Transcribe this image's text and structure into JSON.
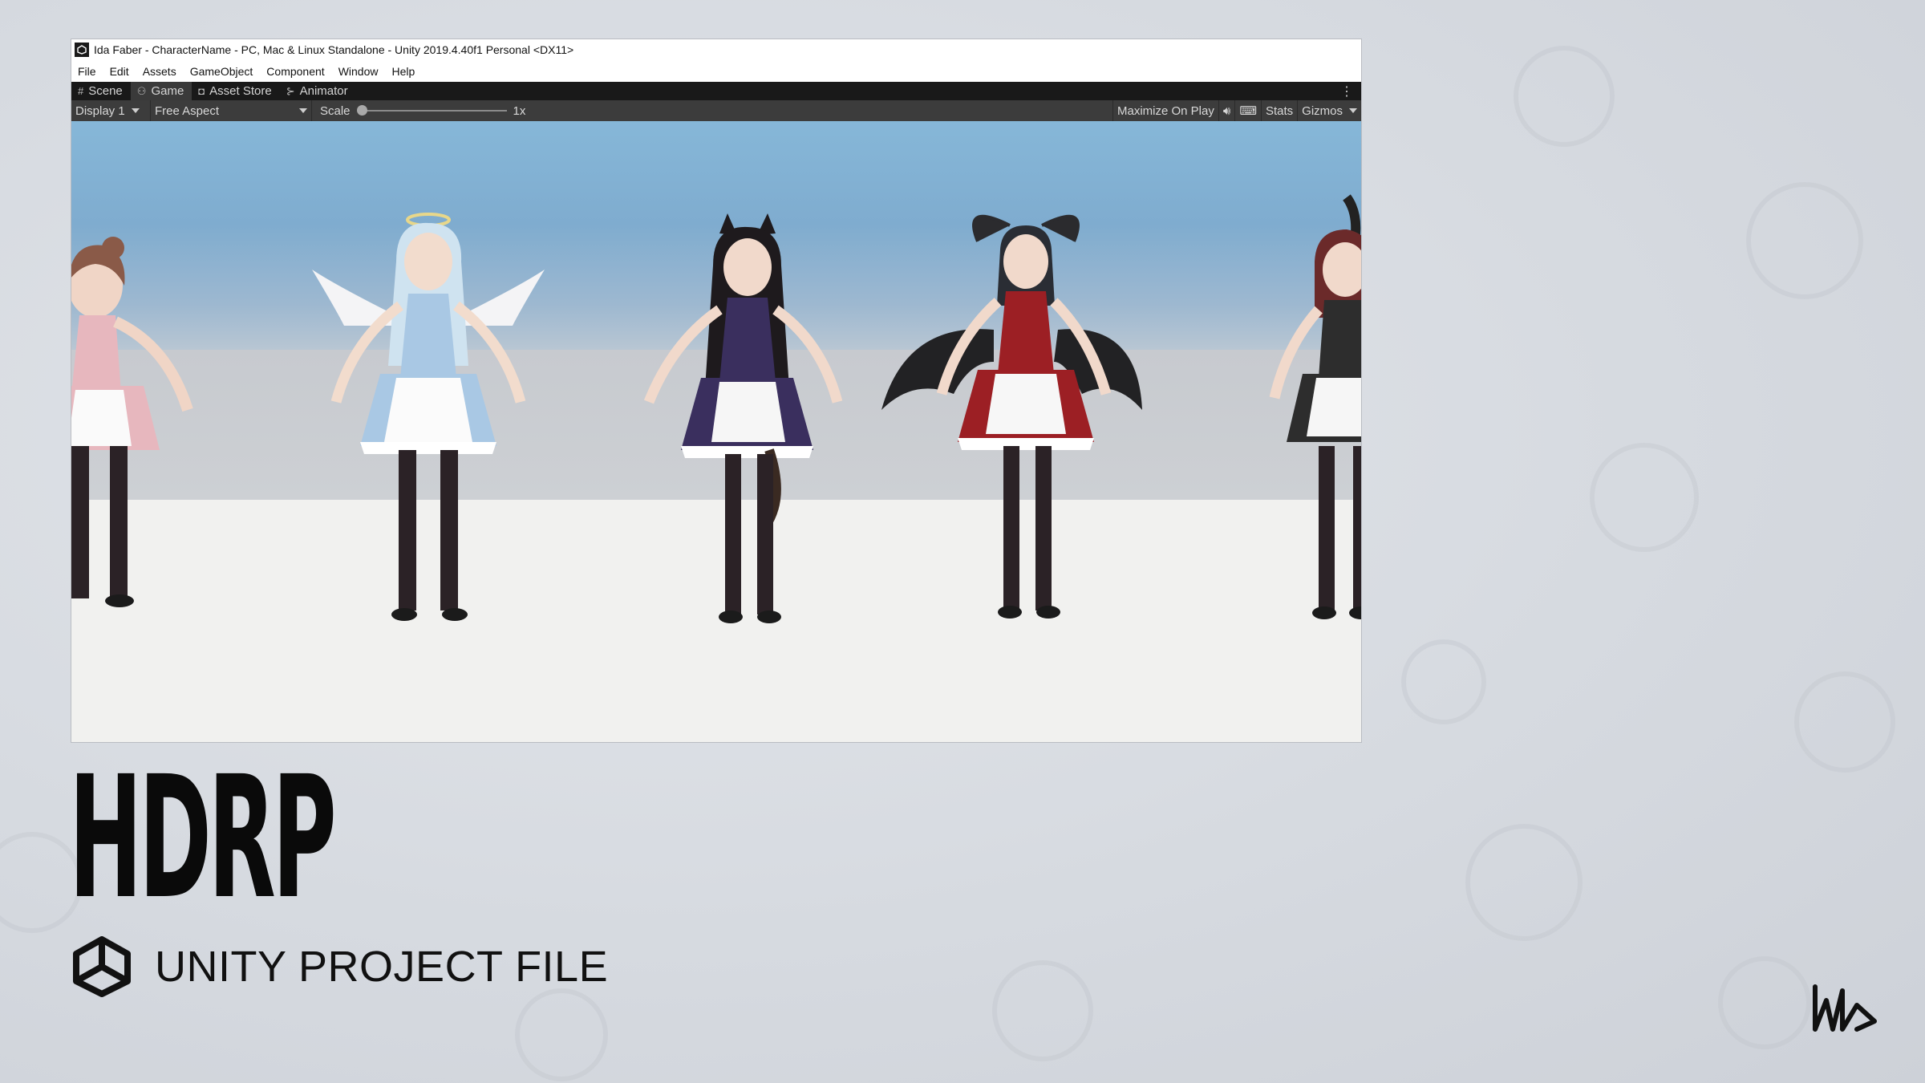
{
  "window": {
    "title": "Ida Faber - CharacterName - PC, Mac & Linux Standalone - Unity 2019.4.40f1 Personal <DX11>"
  },
  "menu": [
    "File",
    "Edit",
    "Assets",
    "GameObject",
    "Component",
    "Window",
    "Help"
  ],
  "tabs": [
    {
      "label": "Scene",
      "icon": "grid-icon"
    },
    {
      "label": "Game",
      "icon": "gamepad-icon"
    },
    {
      "label": "Asset Store",
      "icon": "bag-icon"
    },
    {
      "label": "Animator",
      "icon": "animator-icon"
    }
  ],
  "game_toolbar": {
    "display": "Display 1",
    "aspect": "Free Aspect",
    "scale_label": "Scale",
    "scale_value": "1x",
    "scale_level": 0,
    "maximize": "Maximize On Play",
    "stats": "Stats",
    "gizmos": "Gizmos"
  },
  "scene": {
    "characters": [
      {
        "variant": "pink maid (partially cut off)",
        "dress": "#e9b3bb"
      },
      {
        "variant": "angel maid with halo and wings",
        "dress": "#a8c7e4"
      },
      {
        "variant": "cat-ear maid",
        "dress": "#3a2f5e"
      },
      {
        "variant": "demon maid with horns and bat wings",
        "dress": "#9c1f24"
      },
      {
        "variant": "bunny maid (partially cut off)",
        "dress": "#2d2d2d"
      }
    ]
  },
  "headline": "HDRP",
  "subtitle": "UNITY PROJECT FILE",
  "brand_icon": "ida-logo-icon",
  "engine_icon": "unity-logo-icon"
}
